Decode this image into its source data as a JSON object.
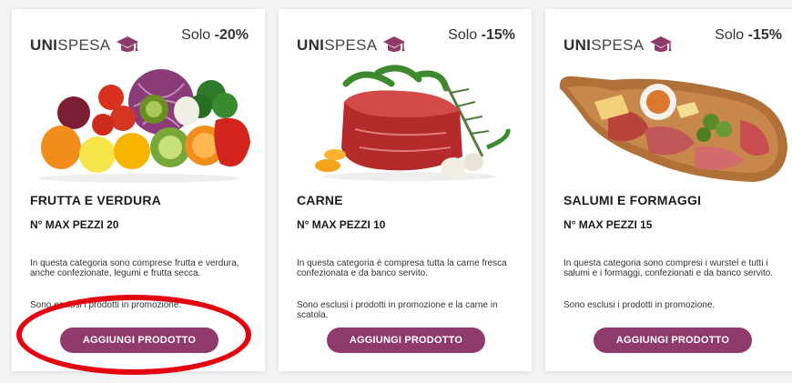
{
  "cards": [
    {
      "brand_bold": "UNI",
      "brand_light": "SPESA",
      "discount_prefix": "Solo ",
      "discount_value": "-20%",
      "title": "FRUTTA E VERDURA",
      "max_pieces": "N° MAX PEZZI 20",
      "description": "In questa categoria sono comprese frutta e verdura, anche confezionate, legumi e frutta secca.",
      "exclusion": "Sono esclusi i prodotti in promozione.",
      "button_label": "AGGIUNGI PRODOTTO",
      "image": "fruit-vegetables"
    },
    {
      "brand_bold": "UNI",
      "brand_light": "SPESA",
      "discount_prefix": "Solo ",
      "discount_value": "-15%",
      "title": "CARNE",
      "max_pieces": "N° MAX PEZZI 10",
      "description": "In questa categoria è compresa tutta la carne fresca confezionata e da banco servito.",
      "exclusion": "Sono esclusi i prodotti in promozione e la carne in scatola.",
      "button_label": "AGGIUNGI PRODOTTO",
      "image": "raw-meat"
    },
    {
      "brand_bold": "UNI",
      "brand_light": "SPESA",
      "discount_prefix": "Solo ",
      "discount_value": "-15%",
      "title": "SALUMI E FORMAGGI",
      "max_pieces": "N° MAX PEZZI 15",
      "description": "In questa categoria sono compresi i wurstel e tutti i salumi e i formaggi, confezionati e da banco servito.",
      "exclusion": "Sono esclusi i prodotti in promozione.",
      "button_label": "AGGIUNGI PRODOTTO",
      "image": "cured-meats-cheese-board"
    }
  ],
  "colors": {
    "brand_purple": "#8f3a6a",
    "annotation_red": "#e4000f",
    "background": "#f3f3f3"
  }
}
